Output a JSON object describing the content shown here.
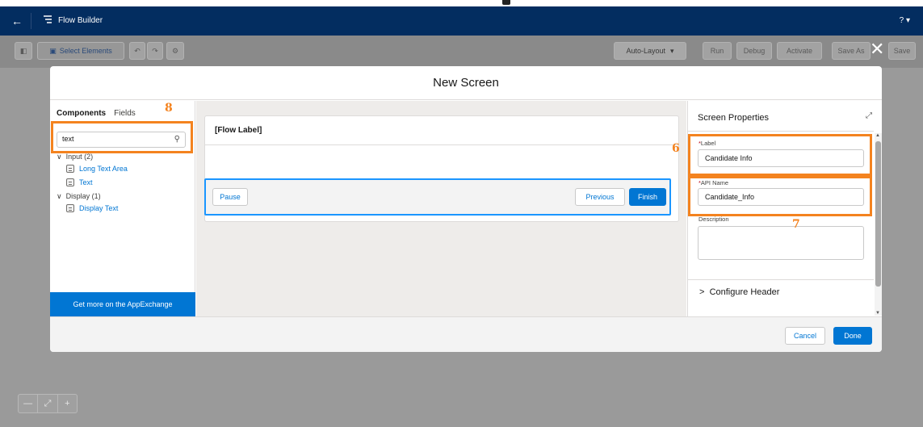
{
  "header": {
    "app_title": "Flow Builder",
    "help_label": "?"
  },
  "toolbar": {
    "select_elements": "Select Elements",
    "layout_mode": "Auto-Layout",
    "run": "Run",
    "debug": "Debug",
    "activate": "Activate",
    "save_as": "Save As",
    "save": "Save"
  },
  "modal": {
    "title": "New Screen",
    "cancel": "Cancel",
    "done": "Done"
  },
  "left_panel": {
    "tab_components": "Components",
    "tab_fields": "Fields",
    "search_value": "text",
    "groups": [
      {
        "label": "Input (2)",
        "items": [
          "Long Text Area",
          "Text"
        ]
      },
      {
        "label": "Display (1)",
        "items": [
          "Display Text"
        ]
      }
    ],
    "appexchange": "Get more on the AppExchange"
  },
  "canvas": {
    "flow_label": "[Flow Label]",
    "pause": "Pause",
    "previous": "Previous",
    "finish": "Finish"
  },
  "properties": {
    "title": "Screen Properties",
    "label_field": "Label",
    "label_value": "Candidate Info",
    "api_field": "API Name",
    "api_value": "Candidate_Info",
    "description_field": "Description",
    "configure_header": "Configure Header"
  },
  "annotations": [
    "8",
    "6",
    "7"
  ],
  "colors": {
    "header": "#032d60",
    "brand": "#0176d3",
    "annotation": "#f4831f"
  }
}
